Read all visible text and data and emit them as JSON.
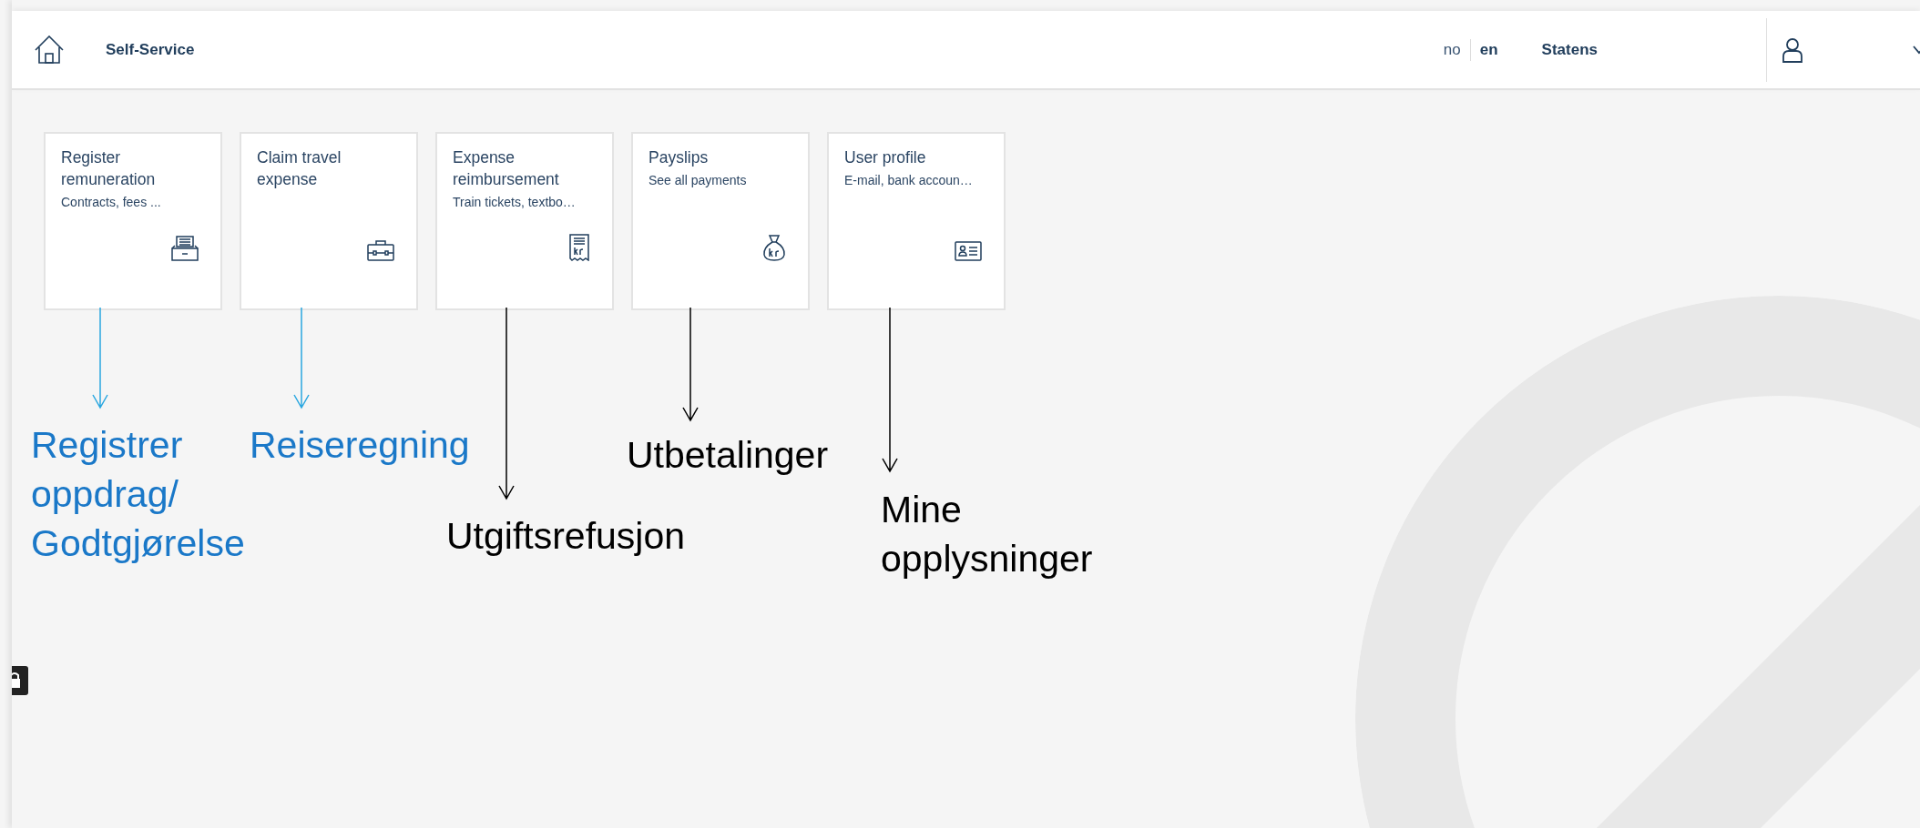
{
  "header": {
    "title": "Self-Service",
    "languages": [
      {
        "label": "no",
        "selected": false
      },
      {
        "label": "en",
        "selected": true
      }
    ],
    "organization": "Statens"
  },
  "tiles": [
    {
      "title": "Register remuneration",
      "subtitle": "Contracts, fees ..."
    },
    {
      "title": "Claim travel expense"
    },
    {
      "title": "Expense reimbursement",
      "subtitle": "Train tickets, textbo…"
    },
    {
      "title": "Payslips",
      "subtitle": "See all payments"
    },
    {
      "title": "User profile",
      "subtitle": "E-mail, bank accoun…"
    }
  ],
  "annotations": [
    {
      "text": "Registrer oppdrag/ Godtgjørelse",
      "color": "#1a78c8"
    },
    {
      "text": "Reiseregning",
      "color": "#1a78c8"
    },
    {
      "text": "Utgiftsrefusjon",
      "color": "#000000"
    },
    {
      "text": "Utbetalinger",
      "color": "#000000"
    },
    {
      "text": "Mine opplysninger",
      "color": "#000000"
    }
  ]
}
